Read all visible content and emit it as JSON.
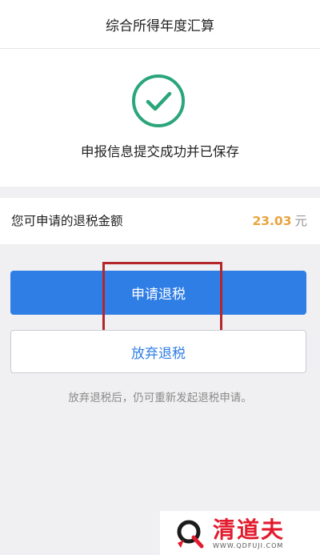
{
  "header": {
    "title": "综合所得年度汇算"
  },
  "success": {
    "icon": "check-circle-icon",
    "message": "申报信息提交成功并已保存",
    "accent": "#2ba57a"
  },
  "refund": {
    "label": "您可申请的退税金额",
    "amount": "23.03",
    "unit": "元",
    "amount_color": "#e8a33d"
  },
  "actions": {
    "apply_label": "申请退税",
    "abandon_label": "放弃退税",
    "primary_color": "#2f7ee6"
  },
  "hint": "放弃退税后，仍可重新发起退税申请。",
  "annotation": {
    "highlight_color": "#b3262b"
  },
  "watermark": {
    "brand": "清道夫",
    "url": "WWW.QDFUJI.COM"
  }
}
